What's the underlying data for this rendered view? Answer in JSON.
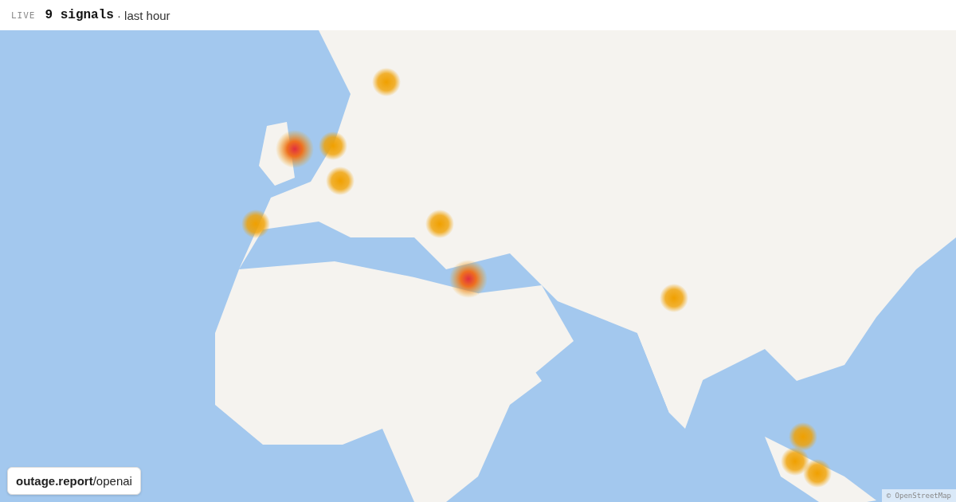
{
  "header": {
    "live_label": "LIVE",
    "signal_count": "9 signals",
    "period": "· last hour"
  },
  "map": {
    "kind": "picture",
    "source_badge": "**outage.report**/openai",
    "attribution": "© OpenStreetMap"
  }
}
